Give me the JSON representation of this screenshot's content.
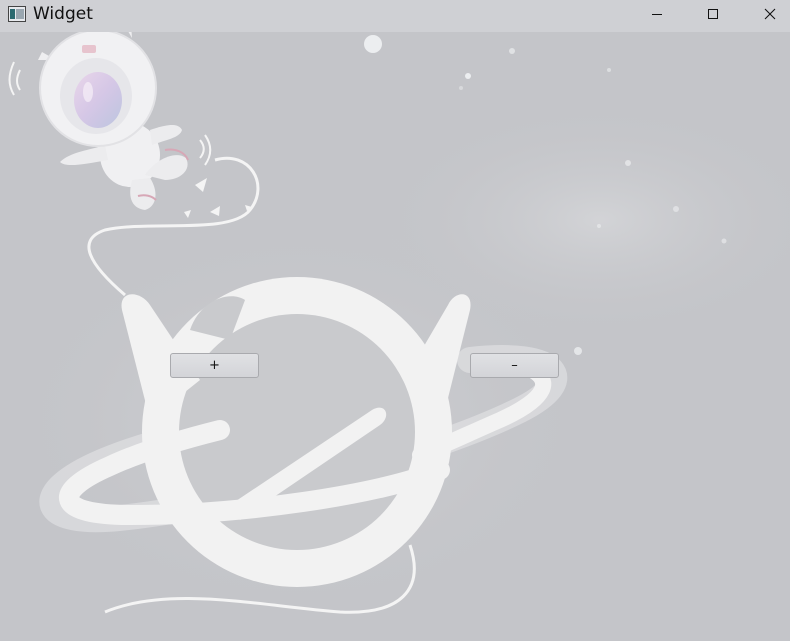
{
  "window": {
    "title": "Widget",
    "icon": "window-app-icon",
    "controls": [
      "minimize-icon",
      "maximize-icon",
      "close-icon"
    ]
  },
  "buttons": {
    "increase_label": "+",
    "decrease_label": "–"
  },
  "colors": {
    "titlebar": "#cfd0d4",
    "background": "#c4c5c9",
    "artwork": "#f2f2f2"
  }
}
